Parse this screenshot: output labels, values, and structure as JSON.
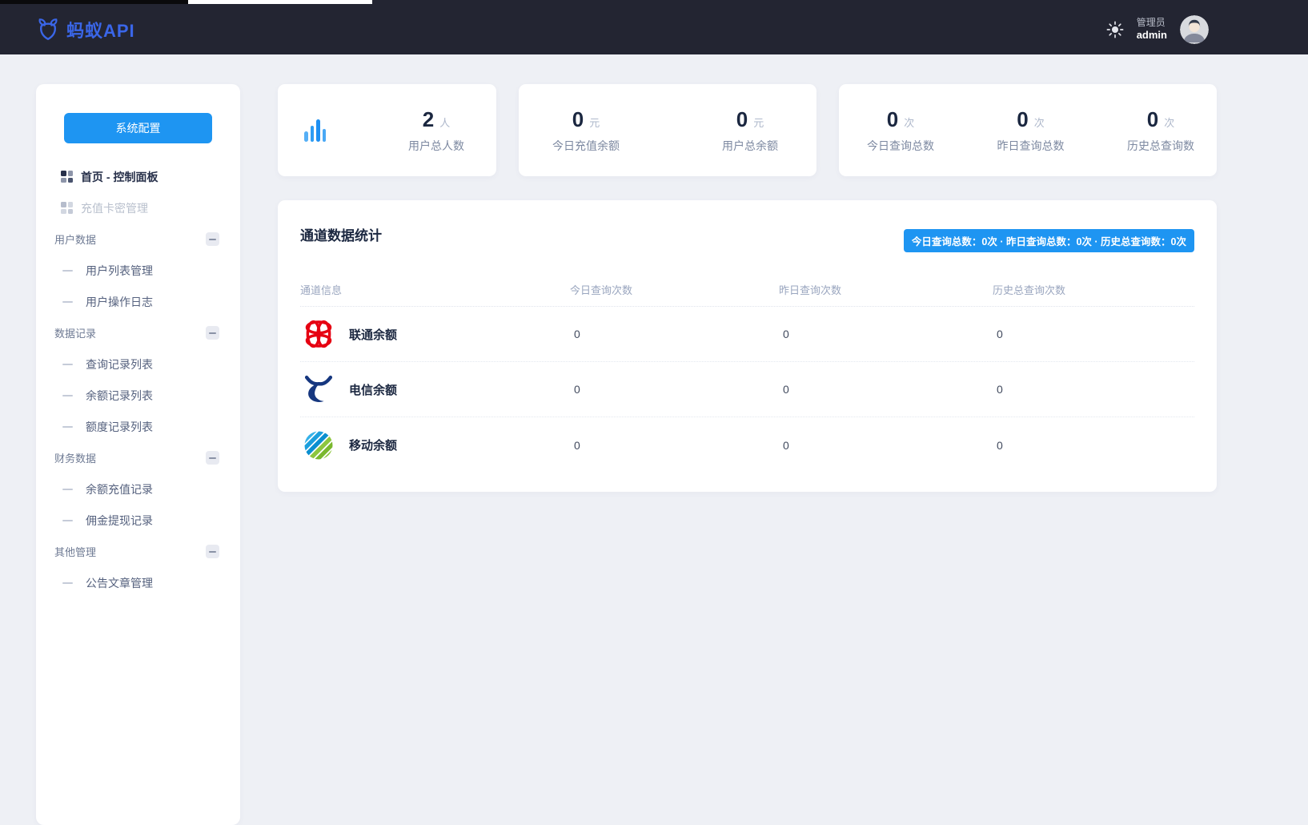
{
  "header": {
    "logo_text": "蚂蚁API",
    "admin_role": "管理员",
    "admin_name": "admin"
  },
  "sidebar": {
    "config_button_label": "系统配置",
    "menu": [
      {
        "label": "首页 - 控制面板",
        "active": true
      },
      {
        "label": "充值卡密管理",
        "active": false
      }
    ],
    "sections": [
      {
        "title": "用户数据",
        "children": [
          "用户列表管理",
          "用户操作日志"
        ]
      },
      {
        "title": "数据记录",
        "children": [
          "查询记录列表",
          "余额记录列表",
          "额度记录列表"
        ]
      },
      {
        "title": "财务数据",
        "children": [
          "余额充值记录",
          "佣金提现记录"
        ]
      },
      {
        "title": "其他管理",
        "children": [
          "公告文章管理"
        ]
      }
    ]
  },
  "stat_cards": [
    {
      "icon": "bar-chart-icon",
      "stats": [
        {
          "value": "2",
          "unit": "人",
          "label": "用户总人数"
        }
      ]
    },
    {
      "stats": [
        {
          "value": "0",
          "unit": "元",
          "label": "今日充值余额"
        },
        {
          "value": "0",
          "unit": "元",
          "label": "用户总余额"
        }
      ]
    },
    {
      "stats": [
        {
          "value": "0",
          "unit": "次",
          "label": "今日查询总数"
        },
        {
          "value": "0",
          "unit": "次",
          "label": "昨日查询总数"
        },
        {
          "value": "0",
          "unit": "次",
          "label": "历史总查询数"
        }
      ]
    }
  ],
  "channel_panel": {
    "title": "通道数据统计",
    "summary_badge": "今日查询总数：0次 · 昨日查询总数：0次 · 历史总查询数：0次",
    "columns": [
      "通道信息",
      "今日查询次数",
      "昨日查询次数",
      "历史总查询次数"
    ],
    "rows": [
      {
        "logo": "china-unicom-logo",
        "name": "联通余额",
        "today": "0",
        "yesterday": "0",
        "total": "0"
      },
      {
        "logo": "china-telecom-logo",
        "name": "电信余额",
        "today": "0",
        "yesterday": "0",
        "total": "0"
      },
      {
        "logo": "china-mobile-logo",
        "name": "移动余额",
        "today": "0",
        "yesterday": "0",
        "total": "0"
      }
    ]
  },
  "colors": {
    "accent_blue": "#1e95f2",
    "header_bg": "#232532",
    "logo_blue": "#3a66e8",
    "page_bg": "#eef0f5",
    "unicom_red": "#e60012",
    "telecom_blue": "#16377f",
    "mobile_blue": "#1b9fdd",
    "mobile_green": "#8dc63f"
  }
}
